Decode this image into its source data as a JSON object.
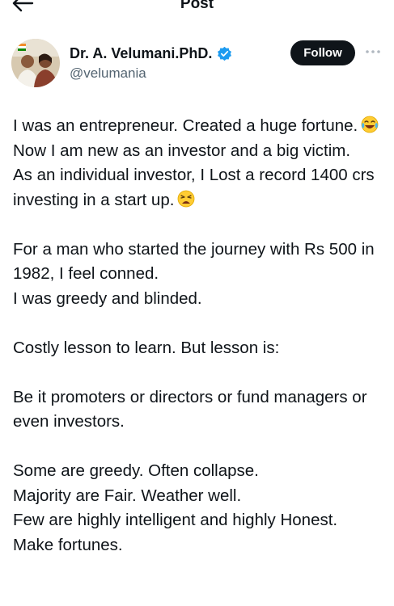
{
  "header": {
    "title": "Post"
  },
  "author": {
    "display_name": "Dr. A. Velumani.PhD.",
    "handle": "@velumania",
    "follow_label": "Follow"
  },
  "post": {
    "paragraphs": [
      [
        "I was an entrepreneur. Created a huge fortune.",
        "Now I am new as an investor and a big victim.",
        "As an individual investor, I Lost a record 1400 crs investing in a start up."
      ],
      [
        "For a man who started the journey with Rs 500 in 1982, I feel conned.",
        "I was greedy and blinded."
      ],
      [
        "Costly lesson to learn. But lesson is:"
      ],
      [
        "Be it promoters or directors or fund managers or even investors."
      ],
      [
        "Some are greedy. Often collapse.",
        "Majority  are Fair. Weather well.",
        "Few are highly intelligent and highly Honest.",
        "Make fortunes."
      ]
    ]
  },
  "icons": {
    "back": "arrow-left-icon",
    "verified": "verified-badge-icon",
    "more": "more-options-icon",
    "emoji_1": "face-with-tears-of-joy-icon",
    "emoji_2": "weary-face-icon"
  },
  "colors": {
    "text": "#0f1419",
    "secondary": "#536471",
    "verified": "#1d9bf0",
    "follow_bg": "#0f1419"
  }
}
